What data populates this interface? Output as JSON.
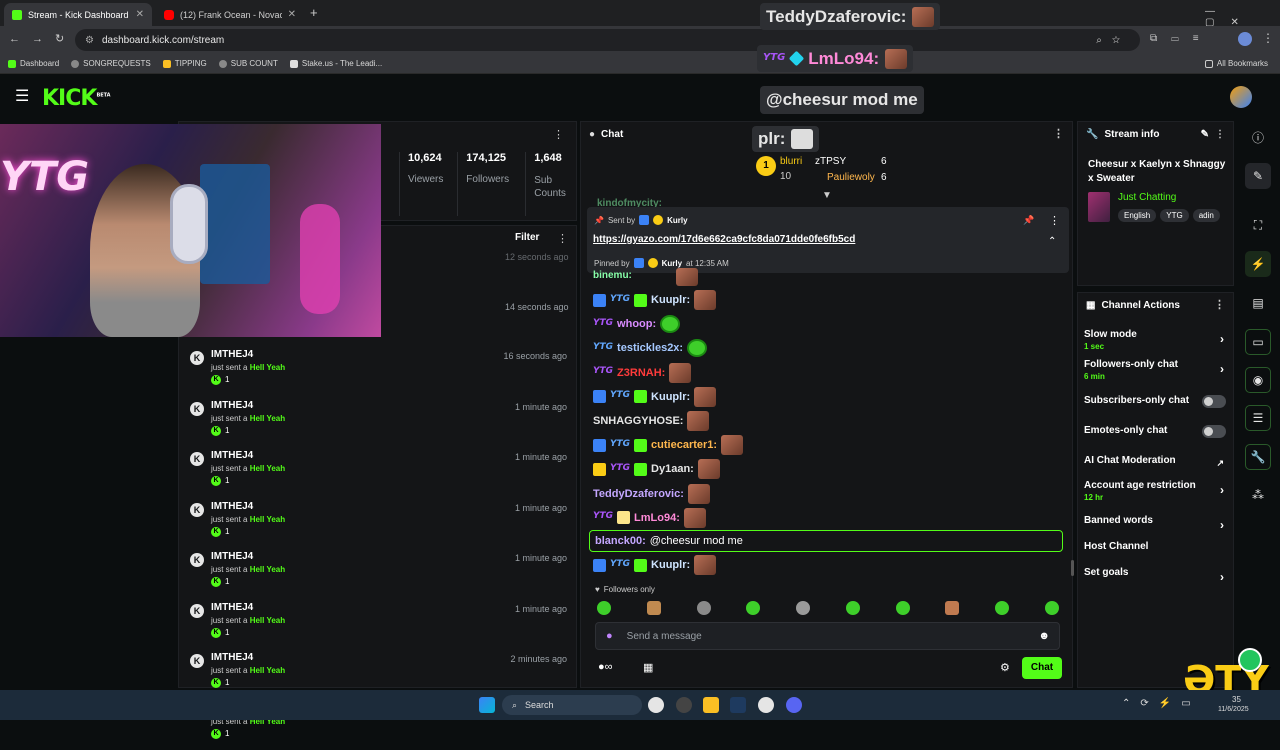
{
  "browser": {
    "tabs": [
      {
        "title": "Stream - Kick Dashboard",
        "active": true
      },
      {
        "title": "(12) Frank Ocean - Novacane (",
        "active": false
      }
    ],
    "new_tab": "+",
    "url": "dashboard.kick.com/stream",
    "bookmarks": [
      "Dashboard",
      "SONGREQUESTS",
      "TIPPING",
      "SUB COUNT",
      "Stake.us - The Leadi..."
    ],
    "all_bookmarks": "All Bookmarks"
  },
  "kick": {
    "logo": "KICK",
    "logo_tag": "BETA"
  },
  "stats": {
    "viewers_value": "10,624",
    "viewers_label": "Viewers",
    "followers_value": "174,125",
    "followers_label": "Followers",
    "subs_value": "1,648",
    "subs_label": "Sub Counts"
  },
  "activity": {
    "filter_label": "Filter",
    "partial_times": [
      "12 seconds ago",
      "14 seconds ago"
    ],
    "items": [
      {
        "user": "IMTHEJ4",
        "action": "just sent a",
        "gift": "Hell Yeah",
        "count": "1",
        "time": "16 seconds ago"
      },
      {
        "user": "IMTHEJ4",
        "action": "just sent a",
        "gift": "Hell Yeah",
        "count": "1",
        "time": "1 minute ago"
      },
      {
        "user": "IMTHEJ4",
        "action": "just sent a",
        "gift": "Hell Yeah",
        "count": "1",
        "time": "1 minute ago"
      },
      {
        "user": "IMTHEJ4",
        "action": "just sent a",
        "gift": "Hell Yeah",
        "count": "1",
        "time": "1 minute ago"
      },
      {
        "user": "IMTHEJ4",
        "action": "just sent a",
        "gift": "Hell Yeah",
        "count": "1",
        "time": "1 minute ago"
      },
      {
        "user": "IMTHEJ4",
        "action": "just sent a",
        "gift": "Hell Yeah",
        "count": "1",
        "time": "1 minute ago"
      },
      {
        "user": "IMTHEJ4",
        "action": "just sent a",
        "gift": "Hell Yeah",
        "count": "1",
        "time": "2 minutes ago"
      },
      {
        "user": "IMTHEJ4",
        "action": "just sent a",
        "gift": "Hell Yeah",
        "count": "1",
        "time": "2 minutes ago"
      }
    ]
  },
  "chat": {
    "title": "Chat",
    "leaders": [
      {
        "rank": "1",
        "name": "blurri",
        "count": "10"
      },
      {
        "name": "zTPSY",
        "count": "6"
      },
      {
        "name": "Pauliewoly",
        "count": "6"
      }
    ],
    "partial_top": "kindofmycity:",
    "pinned": {
      "sent_by_label": "Sent by",
      "sent_by_user": "Kurly",
      "link": "https://gyazo.com/17d6e662ca9cfc8da071dde0fe6fb5cd",
      "pinned_by_label": "Pinned by",
      "pinned_by_user": "Kurly",
      "pinned_time": "at 12:35 AM"
    },
    "partial_msg": "binemu:",
    "messages": [
      {
        "user": "Kuuplr:",
        "color": "#cfe4ff"
      },
      {
        "user": "whoop:",
        "color": "#d98cff"
      },
      {
        "user": "testickles2x:",
        "color": "#a5c8ff"
      },
      {
        "user": "Z3RNAH:",
        "color": "#ff3b3b"
      },
      {
        "user": "Kuuplr:",
        "color": "#cfe4ff"
      },
      {
        "user": "SNHAGGYHOSE:",
        "color": "#e6e6e6"
      },
      {
        "user": "cutiecarter1:",
        "color": "#ffb74d"
      },
      {
        "user": "Dy1aan:",
        "color": "#e6e6e6"
      },
      {
        "user": "TeddyDzaferovic:",
        "color": "#c4a7ff"
      },
      {
        "user": "LmLo94:",
        "color": "#ff8ad8"
      }
    ],
    "highlight": {
      "user": "blanck00:",
      "text": "@cheesur mod me"
    },
    "last": {
      "user": "Kuuplr:"
    },
    "followers_only": "Followers only",
    "input_placeholder": "Send a message",
    "send_label": "Chat"
  },
  "stream_info": {
    "title": "Stream info",
    "stream_title": "Cheesur x Kaelyn x Shnaggy x Sweater",
    "category": "Just Chatting",
    "tags": [
      "English",
      "YTG",
      "adin"
    ]
  },
  "channel_actions": {
    "title": "Channel Actions",
    "items": [
      {
        "label": "Slow mode",
        "sub": "1 sec",
        "control": "chevron"
      },
      {
        "label": "Followers-only chat",
        "sub": "6 min",
        "control": "chevron"
      },
      {
        "label": "Subscribers-only chat",
        "sub": "",
        "control": "toggle"
      },
      {
        "label": "Emotes-only chat",
        "sub": "",
        "control": "toggle"
      },
      {
        "label": "AI Chat Moderation",
        "sub": "",
        "control": "external"
      },
      {
        "label": "Account age restriction",
        "sub": "12 hr",
        "control": "chevron"
      },
      {
        "label": "Banned words",
        "sub": "",
        "control": "chevron"
      },
      {
        "label": "Host Channel",
        "sub": "",
        "control": "none"
      },
      {
        "label": "Set goals",
        "sub": "",
        "control": "chevron"
      }
    ]
  },
  "overlay": {
    "line1": "TeddyDzaferovic:",
    "line2": "LmLo94:",
    "line3": "@cheesur mod me",
    "partial": "plr:",
    "webcam_neon": "YTG",
    "brand_corner": "ƏTY"
  },
  "taskbar": {
    "search": "Search",
    "date": "11/6/2025",
    "clock": "35"
  },
  "colors": {
    "accent": "#53fc18",
    "panel": "#141517",
    "bg": "#0b0e0f"
  }
}
